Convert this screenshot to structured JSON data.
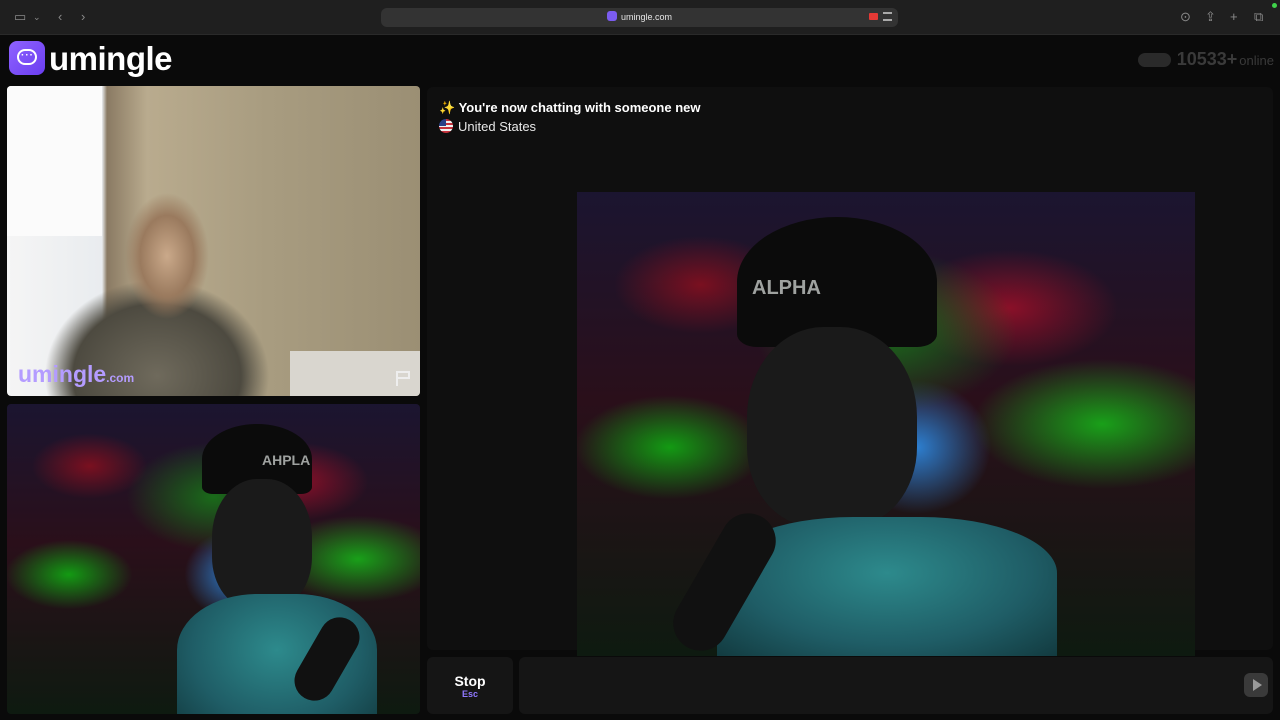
{
  "browser": {
    "url": "umingle.com",
    "icons": [
      "sidebar-icon",
      "back-icon",
      "forward-icon",
      "download-icon",
      "share-icon",
      "new-tab-icon",
      "tabs-overview-icon"
    ]
  },
  "site": {
    "logo_text": "umingle",
    "online_count": "10533+",
    "online_label": "online"
  },
  "stranger_video": {
    "watermark_main": "umingle",
    "watermark_suffix": ".com"
  },
  "chat": {
    "status_line": "You're now chatting with someone new",
    "status_emoji": "✨",
    "country": "United States"
  },
  "self_video": {
    "cap_text": "AHPLA"
  },
  "remote_video": {
    "cap_text": "ALPHA"
  },
  "controls": {
    "stop_label": "Stop",
    "stop_shortcut": "Esc",
    "message_placeholder": ""
  },
  "colors": {
    "accent": "#7b5cf0",
    "background": "#0a0a0a",
    "panel": "#151515"
  }
}
